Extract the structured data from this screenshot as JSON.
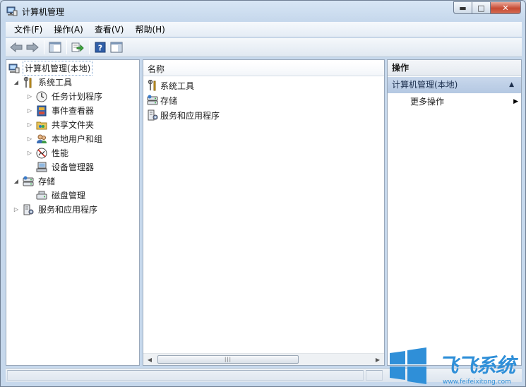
{
  "window": {
    "title": "计算机管理",
    "icon": "computer-management-icon"
  },
  "menu": [
    "文件(F)",
    "操作(A)",
    "查看(V)",
    "帮助(H)"
  ],
  "toolbar": {
    "buttons": [
      "back-arrow-icon",
      "forward-arrow-icon",
      "show-hide-console-tree-icon",
      "export-list-icon",
      "help-icon",
      "show-hide-action-pane-icon"
    ]
  },
  "tree": {
    "root": "计算机管理(本地)",
    "system_tools": "系统工具",
    "task_scheduler": "任务计划程序",
    "event_viewer": "事件查看器",
    "shared_folders": "共享文件夹",
    "local_users": "本地用户和组",
    "performance": "性能",
    "device_manager": "设备管理器",
    "storage": "存储",
    "disk_management": "磁盘管理",
    "services_apps": "服务和应用程序"
  },
  "list": {
    "column_header": "名称",
    "items": [
      "系统工具",
      "存储",
      "服务和应用程序"
    ]
  },
  "actions": {
    "header": "操作",
    "section": "计算机管理(本地)",
    "more": "更多操作"
  },
  "watermark": {
    "brand": "飞飞系统",
    "url": "www.feifeixitong.com"
  },
  "colors": {
    "accent": "#2f8fd8",
    "selected_section": "#b4c8e2"
  }
}
